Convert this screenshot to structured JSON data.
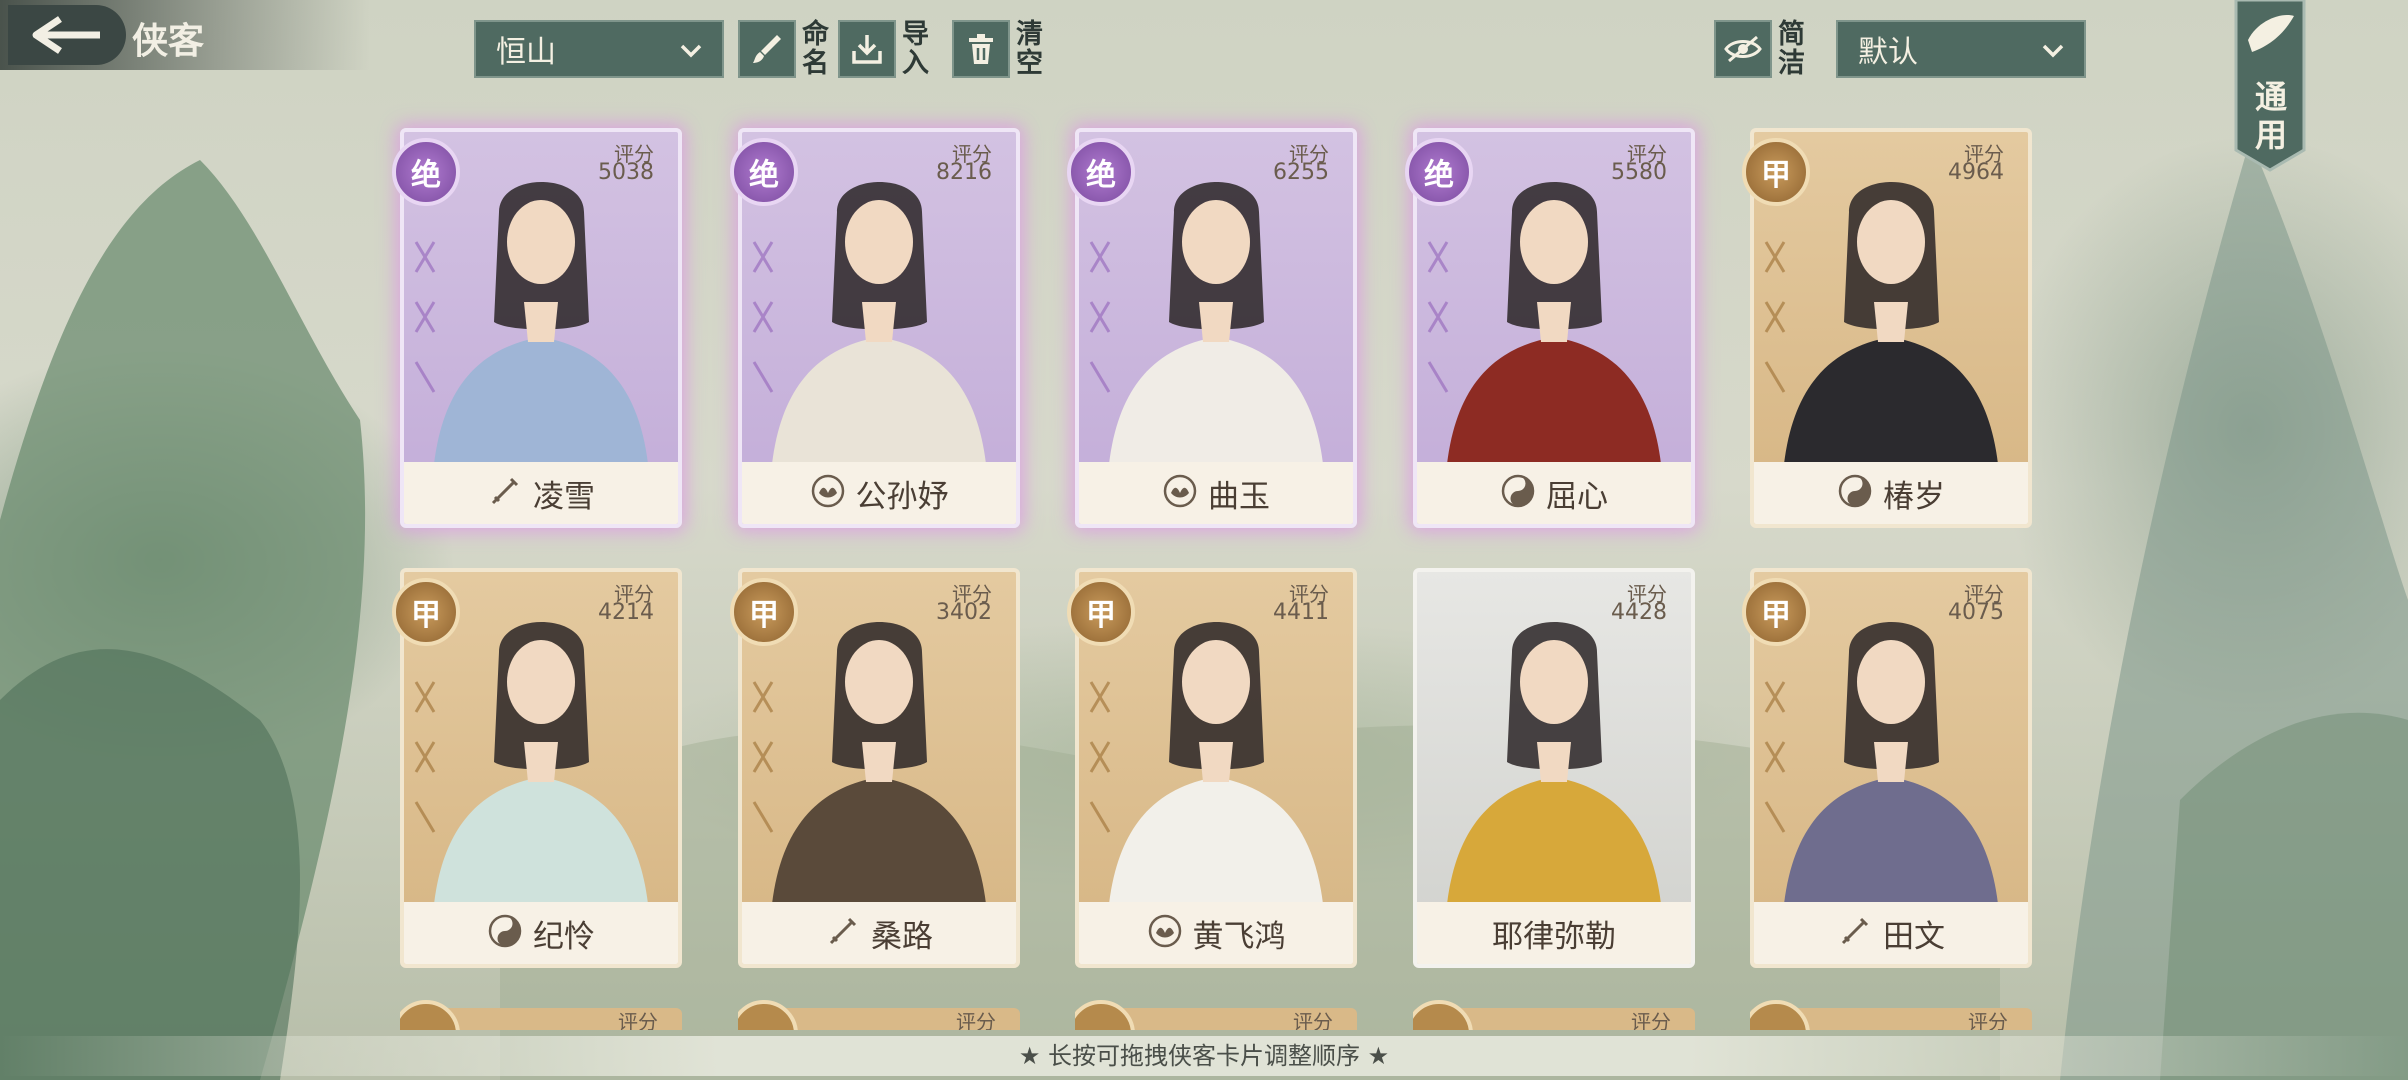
{
  "header": {
    "title": "侠客",
    "sect_select": "恒山",
    "tools": [
      {
        "name": "rename",
        "label": "命名",
        "icon": "brush-icon"
      },
      {
        "name": "import",
        "label": "导入",
        "icon": "import-icon"
      },
      {
        "name": "clear",
        "label": "清空",
        "icon": "trash-icon"
      },
      {
        "name": "simple",
        "label": "简洁",
        "icon": "eye-slash-icon"
      }
    ],
    "sort_select": "默认",
    "generic_tab": "通用"
  },
  "score_label": "评分",
  "cards": [
    {
      "name": "凌雪",
      "score": "5038",
      "rank": "绝",
      "rarity": "jue",
      "school": "sword",
      "color": "#9fb5d6"
    },
    {
      "name": "公孙妤",
      "score": "8216",
      "rank": "绝",
      "rarity": "jue",
      "school": "lotus",
      "color": "#e9e3d7"
    },
    {
      "name": "曲玉",
      "score": "6255",
      "rank": "绝",
      "rarity": "jue",
      "school": "lotus",
      "color": "#f0ece6"
    },
    {
      "name": "屈心",
      "score": "5580",
      "rank": "绝",
      "rarity": "jue",
      "school": "taiji",
      "color": "#8d2b23"
    },
    {
      "name": "椿岁",
      "score": "4964",
      "rank": "甲",
      "rarity": "jia",
      "school": "taiji",
      "color": "#2b2a2e"
    },
    {
      "name": "纪怜",
      "score": "4214",
      "rank": "甲",
      "rarity": "jia",
      "school": "taiji",
      "color": "#cfe2dc"
    },
    {
      "name": "桑路",
      "score": "3402",
      "rank": "甲",
      "rarity": "jia",
      "school": "sword",
      "color": "#5a4a3a"
    },
    {
      "name": "黄飞鸿",
      "score": "4411",
      "rank": "甲",
      "rarity": "jia",
      "school": "lotus",
      "color": "#f2f0ea"
    },
    {
      "name": "耶律弥勒",
      "score": "4428",
      "rank": "",
      "rarity": "none",
      "school": "",
      "color": "#d7a83a"
    },
    {
      "name": "田文",
      "score": "4075",
      "rank": "甲",
      "rarity": "jia",
      "school": "sword",
      "color": "#6f6d8e"
    }
  ],
  "hint": "★ 长按可拖拽侠客卡片调整顺序 ★"
}
